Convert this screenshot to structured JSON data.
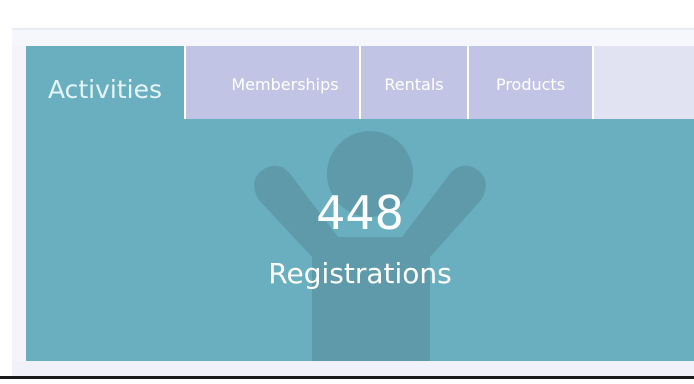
{
  "tabs": {
    "activities": "Activities",
    "memberships": "Memberships",
    "rentals": "Rentals",
    "products": "Products"
  },
  "stat": {
    "value": "448",
    "label": "Registrations"
  },
  "colors": {
    "active_tab": "#6aafbf",
    "inactive_tab": "#c2c4e5",
    "tab_bar_bg": "#e1e3f3",
    "figure": "#5e9aa9"
  },
  "icons": {
    "background_figure": "person-cheering-icon"
  }
}
